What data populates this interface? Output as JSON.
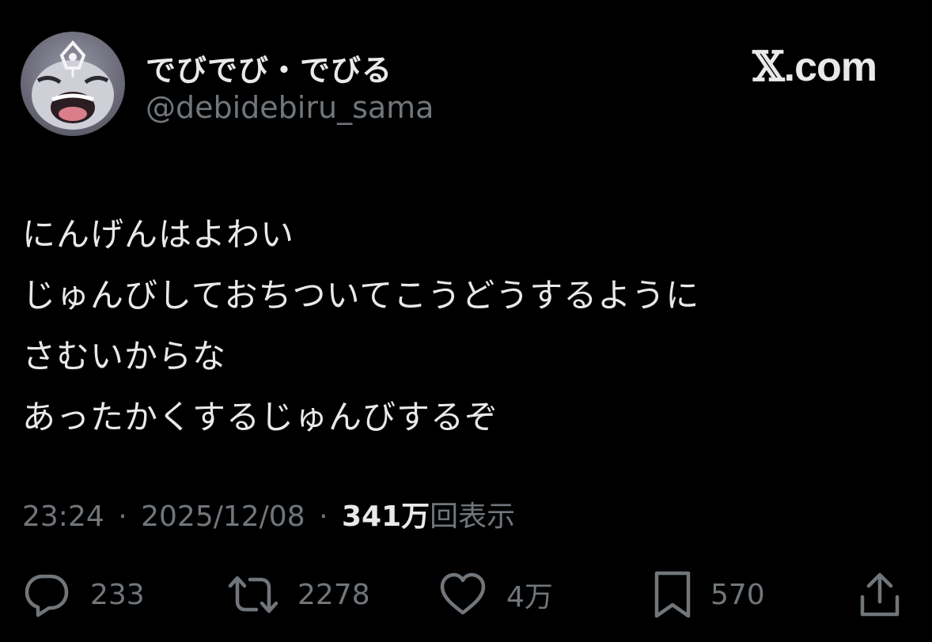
{
  "user": {
    "display_name": "でびでび・でびる",
    "handle": "@debidebiru_sama",
    "avatar_icon": "avatar-image"
  },
  "brand": {
    "x_mark": "𝕏",
    "domain": ".com"
  },
  "tweet": {
    "lines": [
      "にんげんはよわい",
      "じゅんびしておちついてこうどうするように",
      "さむいからな",
      "あったかくするじゅんびするぞ"
    ]
  },
  "meta": {
    "time": "23:24",
    "date": "2025/12/08",
    "separator": "·",
    "views_count": "341万",
    "views_label": "回表示"
  },
  "actions": {
    "reply": {
      "icon": "reply-icon",
      "count": "233"
    },
    "retweet": {
      "icon": "retweet-icon",
      "count": "2278"
    },
    "like": {
      "icon": "like-icon",
      "count": "4万"
    },
    "bookmark": {
      "icon": "bookmark-icon",
      "count": "570"
    },
    "share": {
      "icon": "share-icon"
    }
  },
  "colors": {
    "background": "#000000",
    "primary_text": "#e7e9ea",
    "secondary_text": "#71767b"
  }
}
